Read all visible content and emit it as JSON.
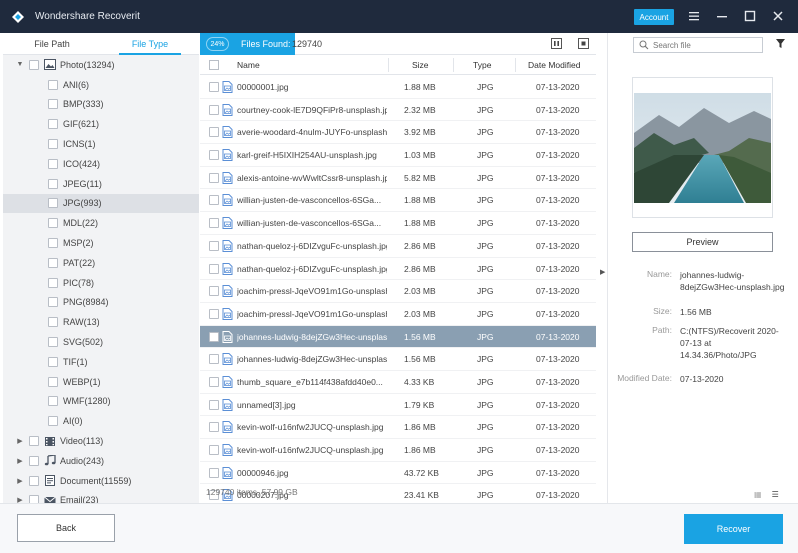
{
  "app": {
    "title": "Wondershare Recoverit",
    "account_label": "Account",
    "icons": [
      "wondershare-logo",
      "menu-icon",
      "minimize-icon",
      "maximize-icon",
      "close-icon"
    ]
  },
  "sidebar": {
    "tabs": [
      {
        "label": "File Path",
        "active": false
      },
      {
        "label": "File Type",
        "active": true
      }
    ],
    "tree": [
      {
        "label": "Photo(13294)",
        "level": 0,
        "arrow": "▼",
        "icon": "image-icon"
      },
      {
        "label": "ANI(6)",
        "level": 1
      },
      {
        "label": "BMP(333)",
        "level": 1
      },
      {
        "label": "GIF(621)",
        "level": 1
      },
      {
        "label": "ICNS(1)",
        "level": 1
      },
      {
        "label": "ICO(424)",
        "level": 1
      },
      {
        "label": "JPEG(11)",
        "level": 1
      },
      {
        "label": "JPG(993)",
        "level": 1,
        "selected": true
      },
      {
        "label": "MDL(22)",
        "level": 1
      },
      {
        "label": "MSP(2)",
        "level": 1
      },
      {
        "label": "PAT(22)",
        "level": 1
      },
      {
        "label": "PIC(78)",
        "level": 1
      },
      {
        "label": "PNG(8984)",
        "level": 1
      },
      {
        "label": "RAW(13)",
        "level": 1
      },
      {
        "label": "SVG(502)",
        "level": 1
      },
      {
        "label": "TIF(1)",
        "level": 1
      },
      {
        "label": "WEBP(1)",
        "level": 1
      },
      {
        "label": "WMF(1280)",
        "level": 1
      },
      {
        "label": "AI(0)",
        "level": 1
      },
      {
        "label": "Video(113)",
        "level": 0,
        "arrow": "▶",
        "icon": "video-icon"
      },
      {
        "label": "Audio(243)",
        "level": 0,
        "arrow": "▶",
        "icon": "audio-icon"
      },
      {
        "label": "Document(11559)",
        "level": 0,
        "arrow": "▶",
        "icon": "document-icon"
      },
      {
        "label": "Email(23)",
        "level": 0,
        "arrow": "▶",
        "icon": "email-icon"
      }
    ]
  },
  "scan": {
    "progress_label": "24%",
    "progress_value": 24,
    "files_found_label": "Files Found:",
    "files_found_count": "129740"
  },
  "table": {
    "columns": [
      "Name",
      "Size",
      "Type",
      "Date Modified"
    ],
    "rows": [
      {
        "name": "00000001.jpg",
        "size": "1.88 MB",
        "type": "JPG",
        "date": "07-13-2020"
      },
      {
        "name": "courtney-cook-lE7D9QFiPr8-unsplash.jpg",
        "size": "2.32 MB",
        "type": "JPG",
        "date": "07-13-2020"
      },
      {
        "name": "averie-woodard-4nulm-JUYFo-unsplash.jpg",
        "size": "3.92 MB",
        "type": "JPG",
        "date": "07-13-2020"
      },
      {
        "name": "karl-greif-H5IXIH254AU-unsplash.jpg",
        "size": "1.03 MB",
        "type": "JPG",
        "date": "07-13-2020"
      },
      {
        "name": "alexis-antoine-wvWwltCssr8-unsplash.jpg",
        "size": "5.82 MB",
        "type": "JPG",
        "date": "07-13-2020"
      },
      {
        "name": "willian-justen-de-vasconcellos-6SGa...",
        "size": "1.88 MB",
        "type": "JPG",
        "date": "07-13-2020"
      },
      {
        "name": "willian-justen-de-vasconcellos-6SGa...",
        "size": "1.88 MB",
        "type": "JPG",
        "date": "07-13-2020"
      },
      {
        "name": "nathan-queloz-j-6DIZvguFc-unsplash.jpg",
        "size": "2.86 MB",
        "type": "JPG",
        "date": "07-13-2020"
      },
      {
        "name": "nathan-queloz-j-6DIZvguFc-unsplash.jpg",
        "size": "2.86 MB",
        "type": "JPG",
        "date": "07-13-2020"
      },
      {
        "name": "joachim-pressl-JqeVO91m1Go-unsplash.jpg",
        "size": "2.03 MB",
        "type": "JPG",
        "date": "07-13-2020"
      },
      {
        "name": "joachim-pressl-JqeVO91m1Go-unsplash.jpg",
        "size": "2.03 MB",
        "type": "JPG",
        "date": "07-13-2020"
      },
      {
        "name": "johannes-ludwig-8dejZGw3Hec-unsplash.jpg",
        "size": "1.56 MB",
        "type": "JPG",
        "date": "07-13-2020",
        "selected": true
      },
      {
        "name": "johannes-ludwig-8dejZGw3Hec-unsplash.jpg",
        "size": "1.56 MB",
        "type": "JPG",
        "date": "07-13-2020"
      },
      {
        "name": "thumb_square_e7b114f438afdd40e0...",
        "size": "4.33 KB",
        "type": "JPG",
        "date": "07-13-2020"
      },
      {
        "name": "unnamed[3].jpg",
        "size": "1.79 KB",
        "type": "JPG",
        "date": "07-13-2020"
      },
      {
        "name": "kevin-wolf-u16nfw2JUCQ-unsplash.jpg",
        "size": "1.86 MB",
        "type": "JPG",
        "date": "07-13-2020"
      },
      {
        "name": "kevin-wolf-u16nfw2JUCQ-unsplash.jpg",
        "size": "1.86 MB",
        "type": "JPG",
        "date": "07-13-2020"
      },
      {
        "name": "00000946.jpg",
        "size": "43.72 KB",
        "type": "JPG",
        "date": "07-13-2020"
      },
      {
        "name": "00000207.jpg",
        "size": "23.41 KB",
        "type": "JPG",
        "date": "07-13-2020"
      }
    ],
    "footer": "129740 items, 57.99 GB"
  },
  "preview": {
    "search_placeholder": "Search file",
    "preview_button": "Preview",
    "meta": [
      {
        "label": "Name:",
        "value": "johannes-ludwig-8dejZGw3Hec-unsplash.jpg"
      },
      {
        "label": "Size:",
        "value": "1.56 MB"
      },
      {
        "label": "Path:",
        "value": "C:(NTFS)/Recoverit 2020-07-13 at 14.34.36/Photo/JPG"
      },
      {
        "label": "Modified Date:",
        "value": "07-13-2020"
      }
    ]
  },
  "bottom": {
    "back_label": "Back",
    "recover_label": "Recover"
  },
  "colors": {
    "titlebar": "#1f2a3d",
    "accent": "#1aa3e3",
    "selected_row": "#8a9fb2",
    "sidebar_bg": "#f2f3f5"
  }
}
